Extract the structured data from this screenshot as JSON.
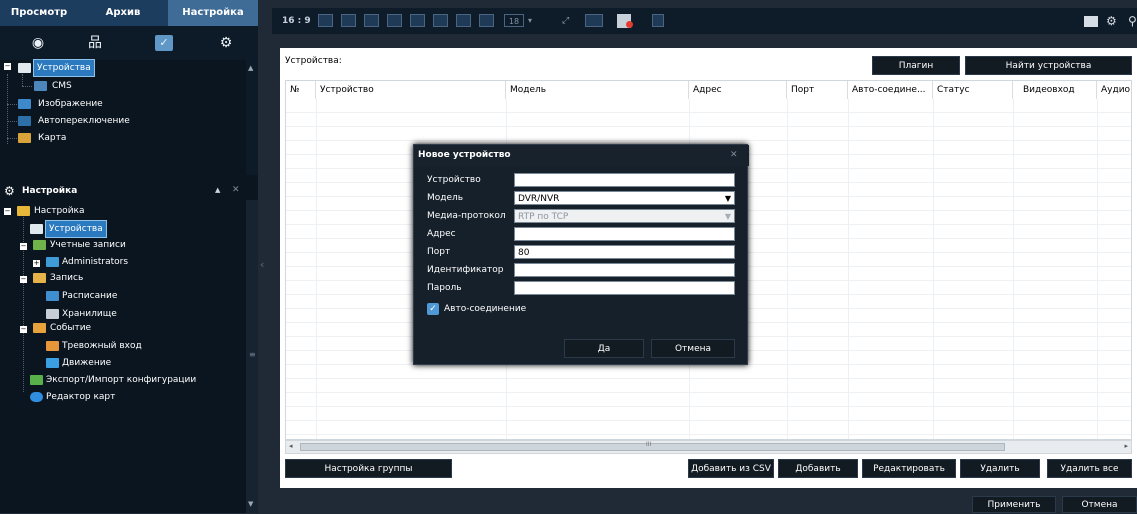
{
  "top_tabs": {
    "view": "Просмотр",
    "archive": "Архив",
    "settings": "Настройка"
  },
  "icon_bar": [
    {
      "icon": "eye-icon",
      "glyph": "◉"
    },
    {
      "icon": "network-icon",
      "glyph": "品"
    },
    {
      "icon": "settings-check-icon",
      "glyph": "✓"
    },
    {
      "icon": "gear-icon",
      "glyph": "⚙"
    }
  ],
  "upper_tree": {
    "devices": "Устройства",
    "cms": "CMS",
    "image": "Изображение",
    "autoswitch": "Автопереключение",
    "map": "Карта"
  },
  "settings_section": {
    "title": "Настройка",
    "collapse": "▲",
    "close": "✕",
    "tree": {
      "root": "Настройка",
      "devices": "Устройства",
      "accounts": "Учетные записи",
      "administrators": "Administrators",
      "record": "Запись",
      "schedule": "Расписание",
      "storage": "Хранилище",
      "event": "Событие",
      "alarm_in": "Тревожный вход",
      "motion": "Движение",
      "export_import": "Экспорт/Импорт конфигурации",
      "map_editor": "Редактор карт"
    }
  },
  "toolbar": {
    "ratio": "16 : 9",
    "count_select": "18"
  },
  "content": {
    "label": "Устройства:",
    "plugin_button": "Плагин",
    "find_button": "Найти устройства",
    "columns": [
      "№",
      "Устройство",
      "Модель",
      "Адрес",
      "Порт",
      "Авто-соедине...",
      "Статус",
      "Видеовход",
      "Аудио"
    ],
    "scroll_mark": "III",
    "buttons": {
      "group_settings": "Настройка группы",
      "add_csv": "Добавить из CSV",
      "add": "Добавить",
      "edit": "Редактировать",
      "delete": "Удалить",
      "delete_all": "Удалить все"
    },
    "apply": "Применить",
    "cancel": "Отмена"
  },
  "dialog": {
    "title": "Новое устройство",
    "close": "✕",
    "labels": {
      "device": "Устройство",
      "model": "Модель",
      "protocol": "Медиа-протокол",
      "address": "Адрес",
      "port": "Порт",
      "identifier": "Идентификатор",
      "password": "Пароль"
    },
    "values": {
      "device": "",
      "model": "DVR/NVR",
      "protocol": "RTP по TCP",
      "address": "",
      "port": "80",
      "identifier": "",
      "password": ""
    },
    "auto_connect": "Авто-соединение",
    "auto_connect_checked": true,
    "ok": "Да",
    "cancel": "Отмена"
  },
  "colors": {
    "accent": "#2b7ac0",
    "tab_active": "#3f6c97",
    "header": "#1d3d5f",
    "panel": "#0b1520",
    "dialog": "#16202a",
    "check": "#4f9ad6"
  }
}
